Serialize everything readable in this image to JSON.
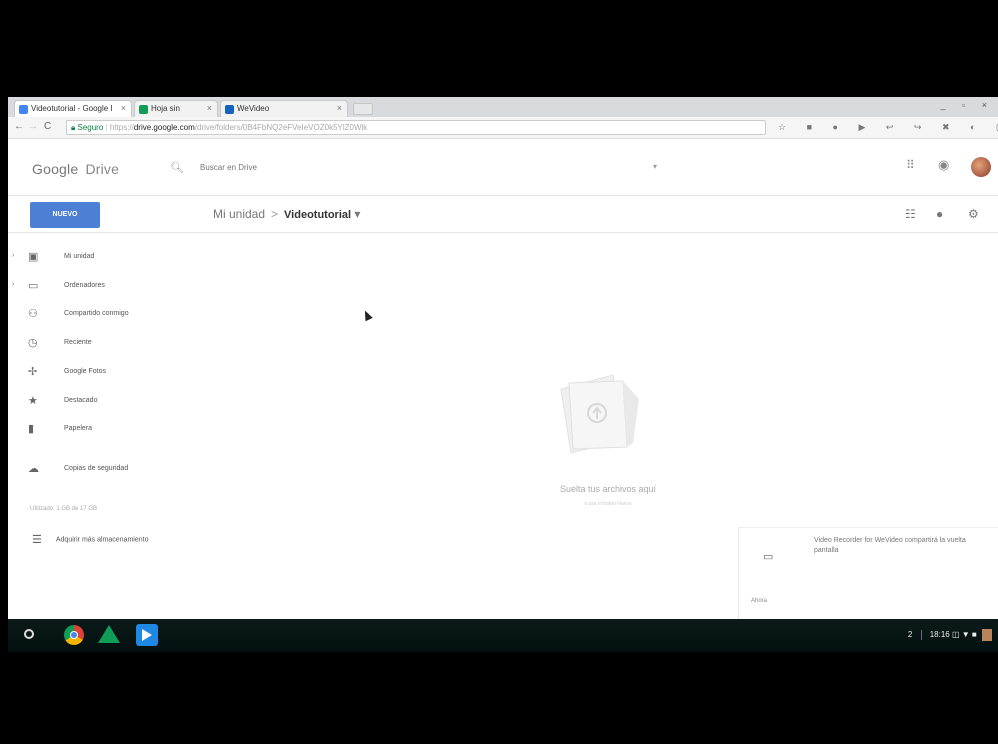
{
  "browser": {
    "tabs": [
      {
        "label": "Videotutorial - Google I",
        "close": "×",
        "color": "#4285f4"
      },
      {
        "label": "Hoja sin",
        "close": "×",
        "color": "#0f9d58"
      },
      {
        "label": "WeVideo",
        "close": "×",
        "color": "#1565c0"
      }
    ],
    "window_controls": "_ ▫ ×",
    "back": "←",
    "forward": "→",
    "reload": "C",
    "address": {
      "secure_label": "Seguro",
      "scheme": "https://",
      "host": "drive.google.com",
      "path": "/drive/folders/0B4FbNQ2eFVeIeVOZ0k5YlZ0Wlk"
    },
    "extension_icons": "☆ ■ ● ▶ ↩ ↪ ✖ ◐ ▢ ⋮"
  },
  "drive": {
    "logo_text": "Google",
    "product_name": "Drive",
    "search_placeholder": "Buscar en Drive",
    "new_button": "NUEVO",
    "breadcrumb": {
      "root": "Mi unidad",
      "separator": ">",
      "current": "Videotutorial",
      "dropdown": "▾"
    },
    "sidebar": [
      {
        "label": "Mi unidad",
        "icon": "drive-icon",
        "glyph": "▣",
        "arrow": "›"
      },
      {
        "label": "Ordenadores",
        "icon": "computer-icon",
        "glyph": "▭",
        "arrow": "›"
      },
      {
        "label": "Compartido conmigo",
        "icon": "people-icon",
        "glyph": "⚇",
        "arrow": ""
      },
      {
        "label": "Reciente",
        "icon": "clock-icon",
        "glyph": "◷",
        "arrow": ""
      },
      {
        "label": "Google Fotos",
        "icon": "pinwheel-icon",
        "glyph": "✢",
        "arrow": ""
      },
      {
        "label": "Destacado",
        "icon": "star-icon",
        "glyph": "★",
        "arrow": ""
      },
      {
        "label": "Papelera",
        "icon": "trash-icon",
        "glyph": "▮",
        "arrow": ""
      }
    ],
    "backup": {
      "label": "Copias de seguridad",
      "icon": "cloud-icon",
      "glyph": "☁"
    },
    "storage_text": "Utilizado: 1 GB de 17 GB",
    "buy_storage": {
      "label": "Adquirir más almacenamiento",
      "glyph": "☰"
    },
    "empty_state": {
      "message": "Suelta tus archivos aquí",
      "submessage": "o usa el botón Nuevo"
    }
  },
  "notification": {
    "text": "Video Recorder for WeVideo compartirá la vuelta pantalla",
    "action": "Ahora",
    "glyph": "▭"
  },
  "shelf": {
    "time": "18:16",
    "tray_icons": "◫ ▼ ■",
    "tray_number": "2",
    "apps": [
      {
        "name": "chrome",
        "color": "#f4b400"
      },
      {
        "name": "drive",
        "color": "#0f9d58"
      },
      {
        "name": "wevideo",
        "color": "#1e88e5"
      }
    ]
  }
}
